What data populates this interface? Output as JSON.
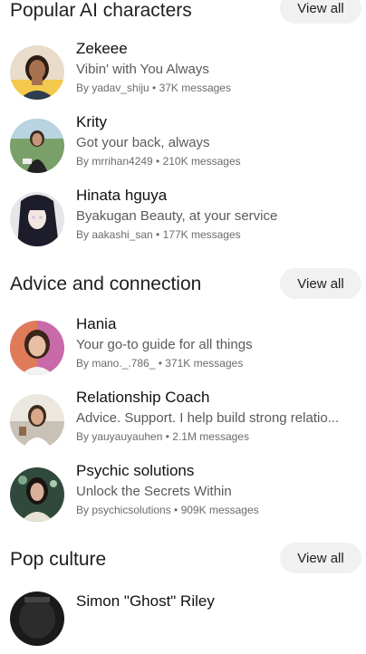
{
  "sections": [
    {
      "title": "Popular AI characters",
      "view_all": "View all",
      "items": [
        {
          "name": "Zekeee",
          "desc": "Vibin' with You Always",
          "meta": "By yadav_shiju • 37K messages"
        },
        {
          "name": "Krity",
          "desc": "Got your back, always",
          "meta": "By mrrihan4249 • 210K messages"
        },
        {
          "name": "Hinata hguya",
          "desc": "Byakugan Beauty, at your service",
          "meta": "By aakashi_san • 177K messages"
        }
      ]
    },
    {
      "title": "Advice and connection",
      "view_all": "View all",
      "items": [
        {
          "name": "Hania",
          "desc": "Your go-to guide for all things",
          "meta": "By mano._.786_ • 371K messages"
        },
        {
          "name": " Relationship Coach",
          "desc": "Advice. Support. I help build strong relatio...",
          "meta": "By yauyauyauhen • 2.1M messages"
        },
        {
          "name": "Psychic solutions",
          "desc": "Unlock the Secrets Within",
          "meta": "By psychicsolutions • 909K messages"
        }
      ]
    },
    {
      "title": "Pop culture",
      "view_all": "View all",
      "items": [
        {
          "name": "Simon \"Ghost\" Riley"
        }
      ]
    }
  ]
}
